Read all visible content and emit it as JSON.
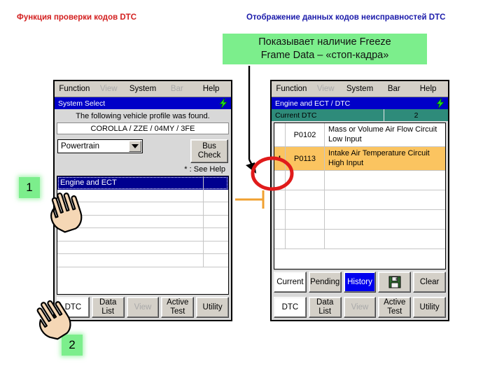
{
  "captions": {
    "left": "Функция проверки кодов DTC",
    "right": "Отображение данных кодов неисправностей DTC"
  },
  "callout": {
    "line1": "Показывает наличие Freeze",
    "line2": "Frame Data – «стоп-кадра»",
    "bg": "#7cee8c"
  },
  "badges": {
    "one": "1",
    "two": "2"
  },
  "left_window": {
    "menu": [
      {
        "label": "Function",
        "dim": false
      },
      {
        "label": "View",
        "dim": true
      },
      {
        "label": "System",
        "dim": false
      },
      {
        "label": "Bar",
        "dim": true
      },
      {
        "label": "Help",
        "dim": false
      }
    ],
    "title": "System Select",
    "message": "The following vehicle profile was found.",
    "profile": "COROLLA / ZZE / 04MY / 3FE",
    "combo_value": "Powertrain",
    "bus_check_line1": "Bus",
    "bus_check_line2": "Check",
    "see_help": "* : See Help",
    "list": [
      {
        "label": "Engine and ECT",
        "selected": true
      },
      {
        "label": "",
        "selected": false
      },
      {
        "label": "",
        "selected": false
      },
      {
        "label": "",
        "selected": false
      },
      {
        "label": "",
        "selected": false
      },
      {
        "label": "",
        "selected": false
      },
      {
        "label": "",
        "selected": false
      }
    ],
    "bottom_buttons": [
      {
        "line1": "DTC",
        "line2": "",
        "dim": false,
        "white": true
      },
      {
        "line1": "Data",
        "line2": "List",
        "dim": false,
        "white": false
      },
      {
        "line1": "View",
        "line2": "",
        "dim": true,
        "white": false
      },
      {
        "line1": "Active",
        "line2": "Test",
        "dim": false,
        "white": false
      },
      {
        "line1": "Utility",
        "line2": "",
        "dim": false,
        "white": false
      }
    ]
  },
  "right_window": {
    "menu": [
      {
        "label": "Function",
        "dim": false
      },
      {
        "label": "View",
        "dim": true
      },
      {
        "label": "System",
        "dim": false
      },
      {
        "label": "Bar",
        "dim": false
      },
      {
        "label": "Help",
        "dim": false
      }
    ],
    "title": "Engine and ECT / DTC",
    "header_label": "Current DTC",
    "header_count": "2",
    "dtc_rows": [
      {
        "bang": "",
        "code": "P0102",
        "desc": "Mass or Volume Air Flow Circuit Low Input",
        "highlight": false
      },
      {
        "bang": "!",
        "code": "P0113",
        "desc": "Intake Air Temperature Circuit High Input",
        "highlight": true
      }
    ],
    "empty_rows": 4,
    "mode_buttons": [
      {
        "label": "Current",
        "state": "white"
      },
      {
        "label": "Pending",
        "state": "normal"
      },
      {
        "label": "History",
        "state": "selected"
      },
      {
        "label": "save-icon",
        "state": "icon"
      },
      {
        "label": "Clear",
        "state": "normal"
      }
    ],
    "bottom_buttons": [
      {
        "line1": "DTC",
        "line2": "",
        "dim": false,
        "white": true
      },
      {
        "line1": "Data",
        "line2": "List",
        "dim": false,
        "white": false
      },
      {
        "line1": "View",
        "line2": "",
        "dim": true,
        "white": false
      },
      {
        "line1": "Active",
        "line2": "Test",
        "dim": false,
        "white": false
      },
      {
        "line1": "Utility",
        "line2": "",
        "dim": false,
        "white": false
      }
    ]
  },
  "colors": {
    "title_blue": "#0000c8",
    "header_teal": "#2e8b7a",
    "highlight_orange": "#fbc460",
    "annotation_red": "#e01b1b",
    "connector_orange": "#f0a030"
  }
}
